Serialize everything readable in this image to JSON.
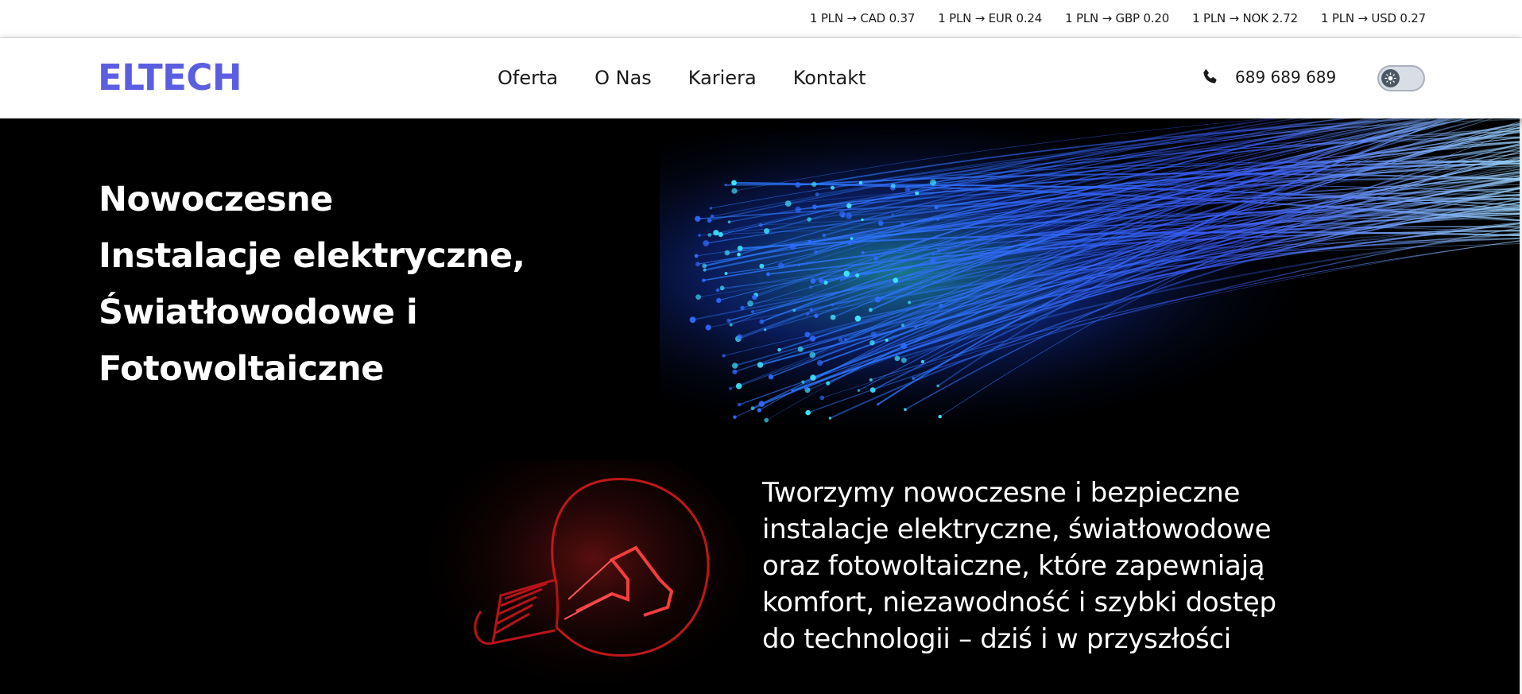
{
  "currency_rates": [
    "1 PLN → CAD 0.37",
    "1 PLN → EUR 0.24",
    "1 PLN → GBP 0.20",
    "1 PLN → NOK 2.72",
    "1 PLN → USD 0.27"
  ],
  "header": {
    "logo": "ELTECH",
    "nav": [
      "Oferta",
      "O Nas",
      "Kariera",
      "Kontakt"
    ],
    "phone": "689 689 689",
    "phone_icon": "phone-icon",
    "theme_toggle_icon": "sun-icon"
  },
  "hero": {
    "title_lines": [
      "Nowoczesne",
      "Instalacje elektryczne,",
      "Światłowodowe i",
      "Fotowoltaiczne"
    ],
    "text_lines": [
      "Tworzymy nowoczesne i bezpieczne",
      "instalacje elektryczne, światłowodowe",
      "oraz fotowoltaiczne, które zapewniają",
      "komfort, niezawodność i szybki dostęp",
      "do technologii – dziś i w przyszłości"
    ]
  },
  "colors": {
    "brand": "#5b5ee0",
    "background": "#000000",
    "header_bg": "#ffffff",
    "fiber_blue": "#1e5bff",
    "bulb_red": "#ff1e1e"
  }
}
